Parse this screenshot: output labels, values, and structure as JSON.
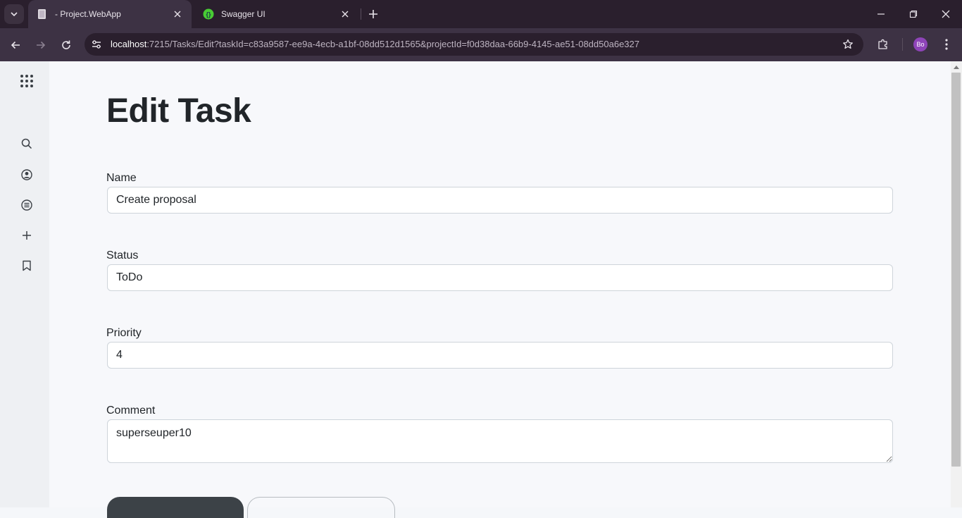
{
  "browser": {
    "tabs": [
      {
        "title": "- Project.WebApp",
        "active": true,
        "icon": "document-icon"
      },
      {
        "title": "Swagger UI",
        "active": false,
        "icon": "swagger-icon"
      }
    ],
    "url_host": "localhost",
    "url_rest": ":7215/Tasks/Edit?taskId=c83a9587-ee9a-4ecb-a1bf-08dd512d1565&projectId=f0d38daa-66b9-4145-ae51-08dd50a6e327",
    "profile_initials": "Bo",
    "colors": {
      "tabstrip": "#2a1f2d",
      "toolbar": "#3d3244",
      "avatar": "#8e44b8"
    }
  },
  "rail": {
    "items": [
      "apps-grid-icon",
      "search-icon",
      "account-icon",
      "list-icon",
      "add-icon",
      "bookmark-icon"
    ]
  },
  "form": {
    "title": "Edit Task",
    "name_label": "Name",
    "name_value": "Create proposal",
    "status_label": "Status",
    "status_value": "ToDo",
    "priority_label": "Priority",
    "priority_value": "4",
    "comment_label": "Comment",
    "comment_value": "superseuper10"
  }
}
